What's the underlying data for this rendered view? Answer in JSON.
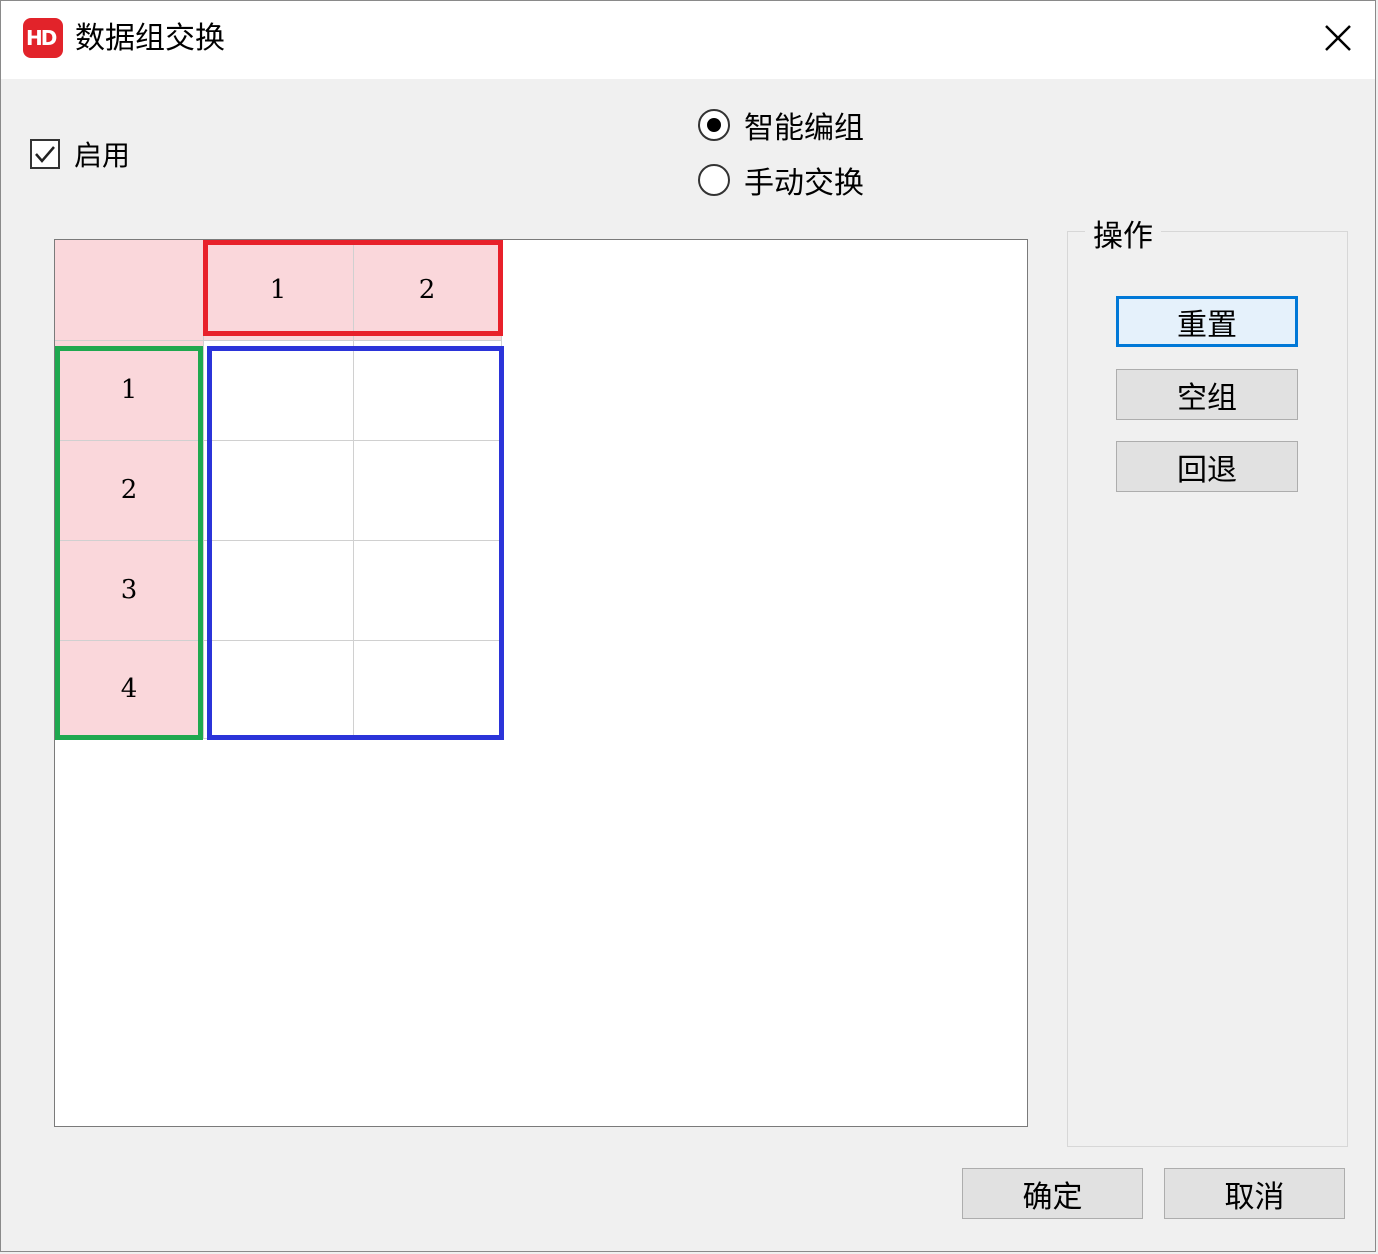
{
  "window": {
    "title": "数据组交换",
    "logo_text": "HD"
  },
  "enable": {
    "label": "启用",
    "checked": true
  },
  "mode": {
    "options": [
      {
        "label": "智能编组",
        "selected": true
      },
      {
        "label": "手动交换",
        "selected": false
      }
    ]
  },
  "grid": {
    "column_headers": [
      "1",
      "2"
    ],
    "row_headers": [
      "1",
      "2",
      "3",
      "4"
    ],
    "cells": [
      [
        "",
        ""
      ],
      [
        "",
        ""
      ],
      [
        "",
        ""
      ],
      [
        "",
        ""
      ]
    ],
    "colors": {
      "header_bg": "#fad7db",
      "column_header_highlight": "#e8202a",
      "row_header_highlight": "#1fa84f",
      "body_highlight": "#2b34d9"
    }
  },
  "operations": {
    "legend": "操作",
    "buttons": [
      {
        "label": "重置",
        "focused": true
      },
      {
        "label": "空组",
        "focused": false
      },
      {
        "label": "回退",
        "focused": false
      }
    ]
  },
  "footer": {
    "ok_label": "确定",
    "cancel_label": "取消"
  },
  "icons": {
    "close": "close-icon",
    "check": "check-icon",
    "logo": "app-logo-icon"
  }
}
